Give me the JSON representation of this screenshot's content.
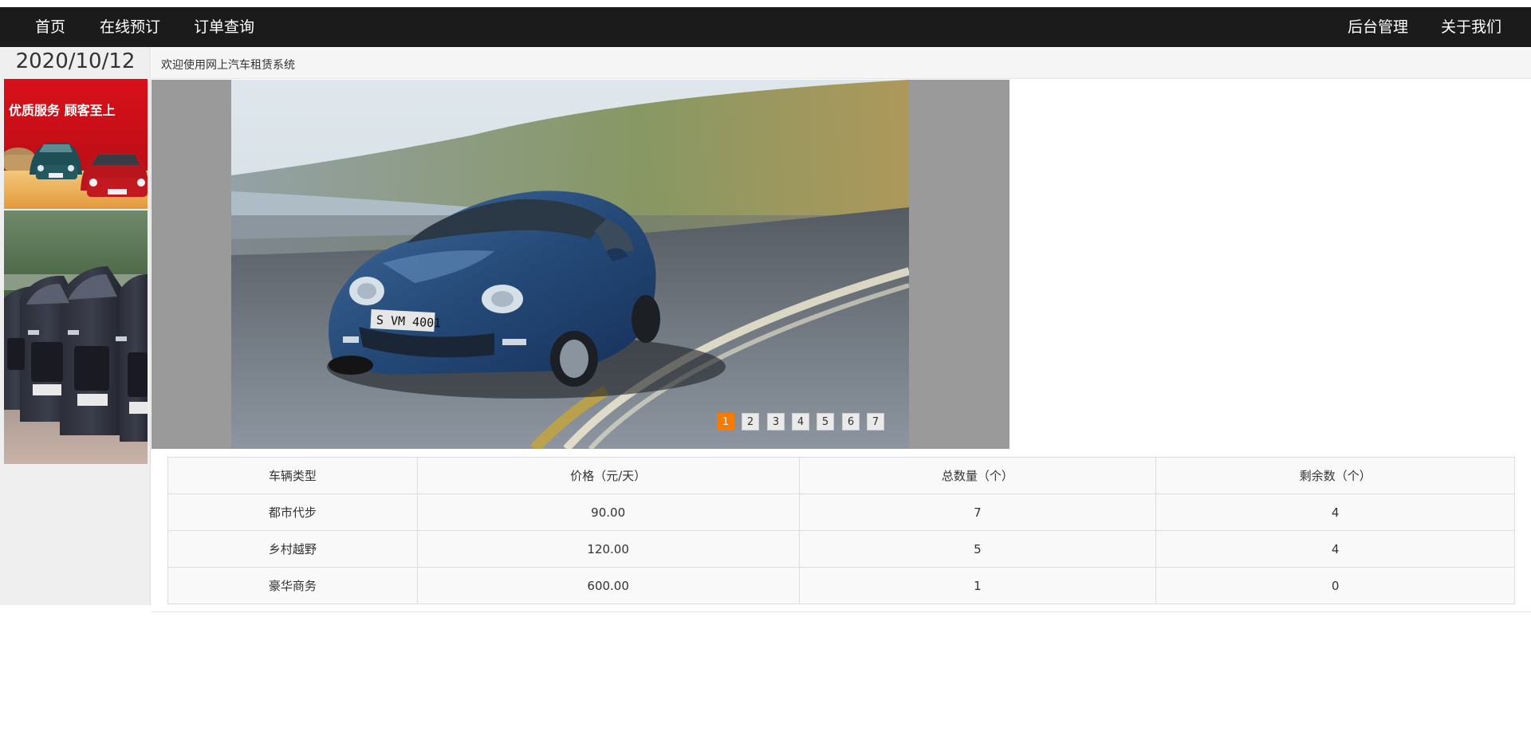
{
  "nav": {
    "home": "首页",
    "booking": "在线预订",
    "orders": "订单查询",
    "admin": "后台管理",
    "about": "关于我们"
  },
  "sidebar": {
    "date": "2020/10/12",
    "ad_slogan": "优质服务  顾客至上"
  },
  "welcome": "欢迎使用网上汽车租赁系统",
  "carousel": {
    "plate": "S VM 4001",
    "pages": [
      "1",
      "2",
      "3",
      "4",
      "5",
      "6",
      "7"
    ],
    "active_page": "1"
  },
  "table": {
    "headers": [
      "车辆类型",
      "价格（元/天）",
      "总数量（个）",
      "剩余数（个）"
    ],
    "rows": [
      [
        "都市代步",
        "90.00",
        "7",
        "4"
      ],
      [
        "乡村越野",
        "120.00",
        "5",
        "4"
      ],
      [
        "豪华商务",
        "600.00",
        "1",
        "0"
      ]
    ]
  },
  "colors": {
    "navbar_bg": "#1b1b1b",
    "active_page": "#f57c00",
    "carousel_bg": "#9a9a9a"
  }
}
